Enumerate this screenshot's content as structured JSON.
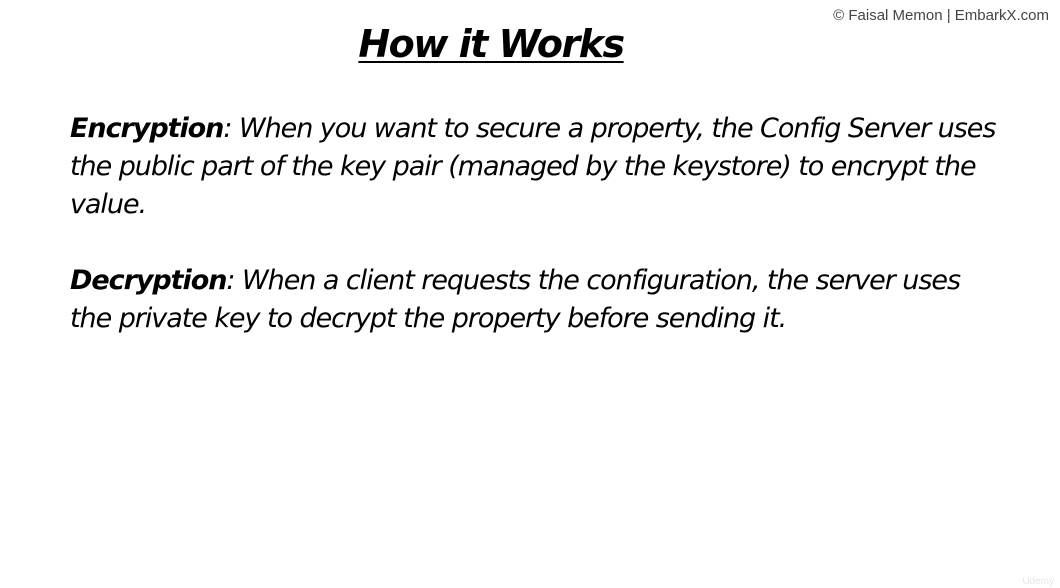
{
  "slide": {
    "copyright": "© Faisal Memon | EmbarkX.com",
    "title": "How it Works",
    "watermark": "Udemy",
    "items": [
      {
        "term": "Encryption",
        "description": ": When you want to secure a property, the Config Server uses the public part of the key pair (managed by the keystore) to encrypt the value."
      },
      {
        "term": "Decryption",
        "description": ": When a client requests the configuration, the server uses the private key to decrypt the property before sending it."
      }
    ]
  }
}
